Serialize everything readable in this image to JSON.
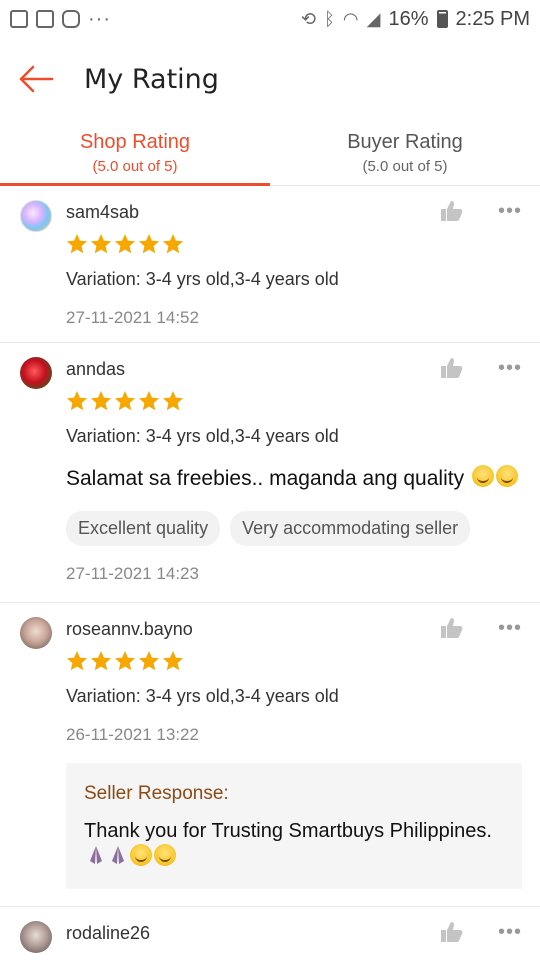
{
  "status_bar": {
    "battery": "16%",
    "time": "2:25 PM",
    "more": "···"
  },
  "header": {
    "title": "My Rating"
  },
  "tabs": [
    {
      "label": "Shop Rating",
      "sub": "(5.0 out of 5)"
    },
    {
      "label": "Buyer Rating",
      "sub": "(5.0 out of 5)"
    }
  ],
  "reviews": [
    {
      "username": "sam4sab",
      "stars": 5,
      "variation": "Variation: 3-4 yrs old,3-4 years old",
      "timestamp": "27-11-2021 14:52"
    },
    {
      "username": "anndas",
      "stars": 5,
      "variation": "Variation: 3-4 yrs old,3-4 years old",
      "comment": "Salamat sa freebies.. maganda ang quality",
      "tags": [
        "Excellent quality",
        "Very accommodating seller"
      ],
      "timestamp": "27-11-2021 14:23"
    },
    {
      "username": "roseannv.bayno",
      "stars": 5,
      "variation": "Variation: 3-4 yrs old,3-4 years old",
      "timestamp": "26-11-2021 13:22",
      "seller_response": {
        "title": "Seller Response:",
        "text": "Thank you for Trusting Smartbuys Philippines."
      }
    },
    {
      "username": "rodaline26"
    }
  ],
  "colors": {
    "accent": "#ee4d2d",
    "star": "#f6a700",
    "seller_title": "#8a4b16"
  }
}
